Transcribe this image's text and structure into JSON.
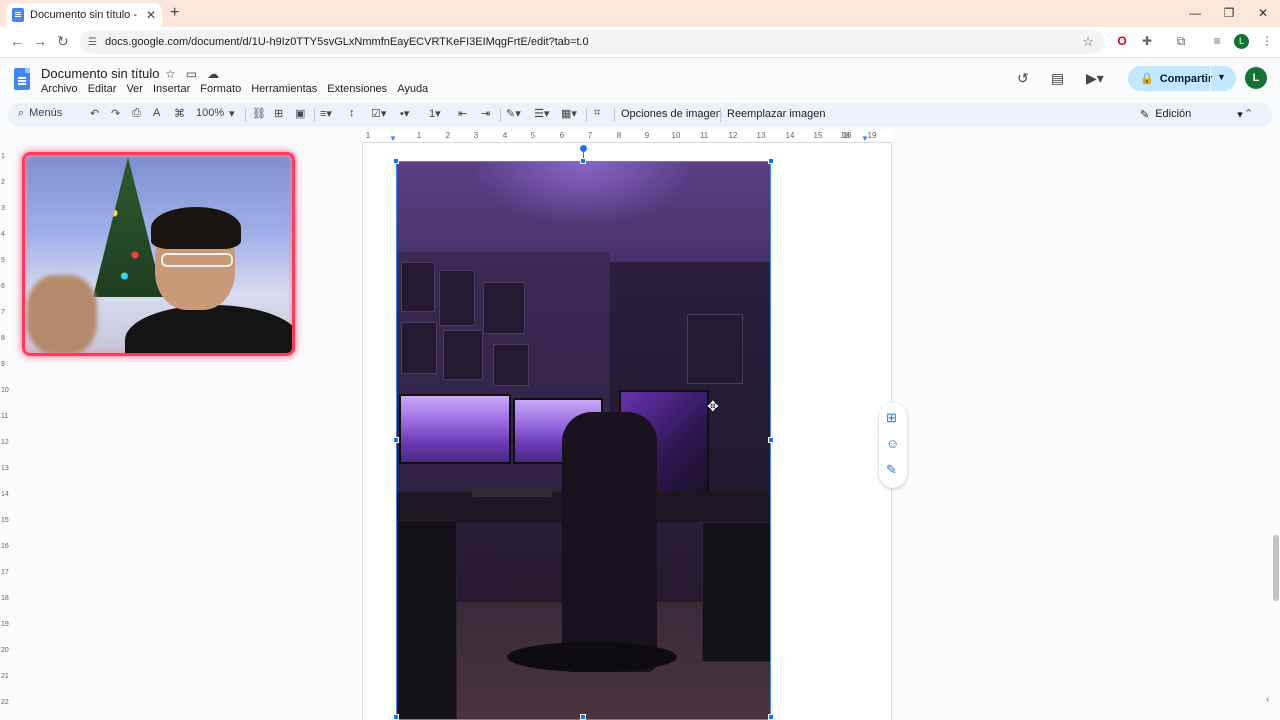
{
  "browser": {
    "tab_title": "Documento sin título - Docum",
    "new_tab": "+",
    "url": "docs.google.com/document/d/1U-h9Iz0TTY5svGLxNmmfnEayECVRTKeFI3EIMqgFrtE/edit?tab=t.0",
    "profile_initial": "L"
  },
  "docs": {
    "doc_title": "Documento sin título",
    "menus": [
      "Archivo",
      "Editar",
      "Ver",
      "Insertar",
      "Formato",
      "Herramientas",
      "Extensiones",
      "Ayuda"
    ],
    "share_label": "Compartir",
    "avatar_initial": "L"
  },
  "toolbar": {
    "search_label": "Menús",
    "zoom": "100%",
    "image_options": "Opciones de imagen",
    "replace_image": "Reemplazar imagen",
    "mode": "Edición"
  },
  "ruler": {
    "h_ticks": [
      "1",
      "1",
      "2",
      "3",
      "4",
      "5",
      "6",
      "7",
      "8",
      "9",
      "10",
      "11",
      "12",
      "13",
      "14",
      "15",
      "16",
      "17",
      "18",
      "19"
    ],
    "v_ticks": [
      "1",
      "2",
      "3",
      "4",
      "5",
      "6",
      "7",
      "8",
      "9",
      "10",
      "11",
      "12",
      "13",
      "14",
      "15",
      "16",
      "17",
      "18",
      "19",
      "20",
      "21",
      "22"
    ]
  },
  "colors": {
    "accent": "#1a73e8",
    "share_bg": "#c2e7ff",
    "toolbar_bg": "#edf2fa",
    "webcam_border": "#ff3a5c"
  }
}
